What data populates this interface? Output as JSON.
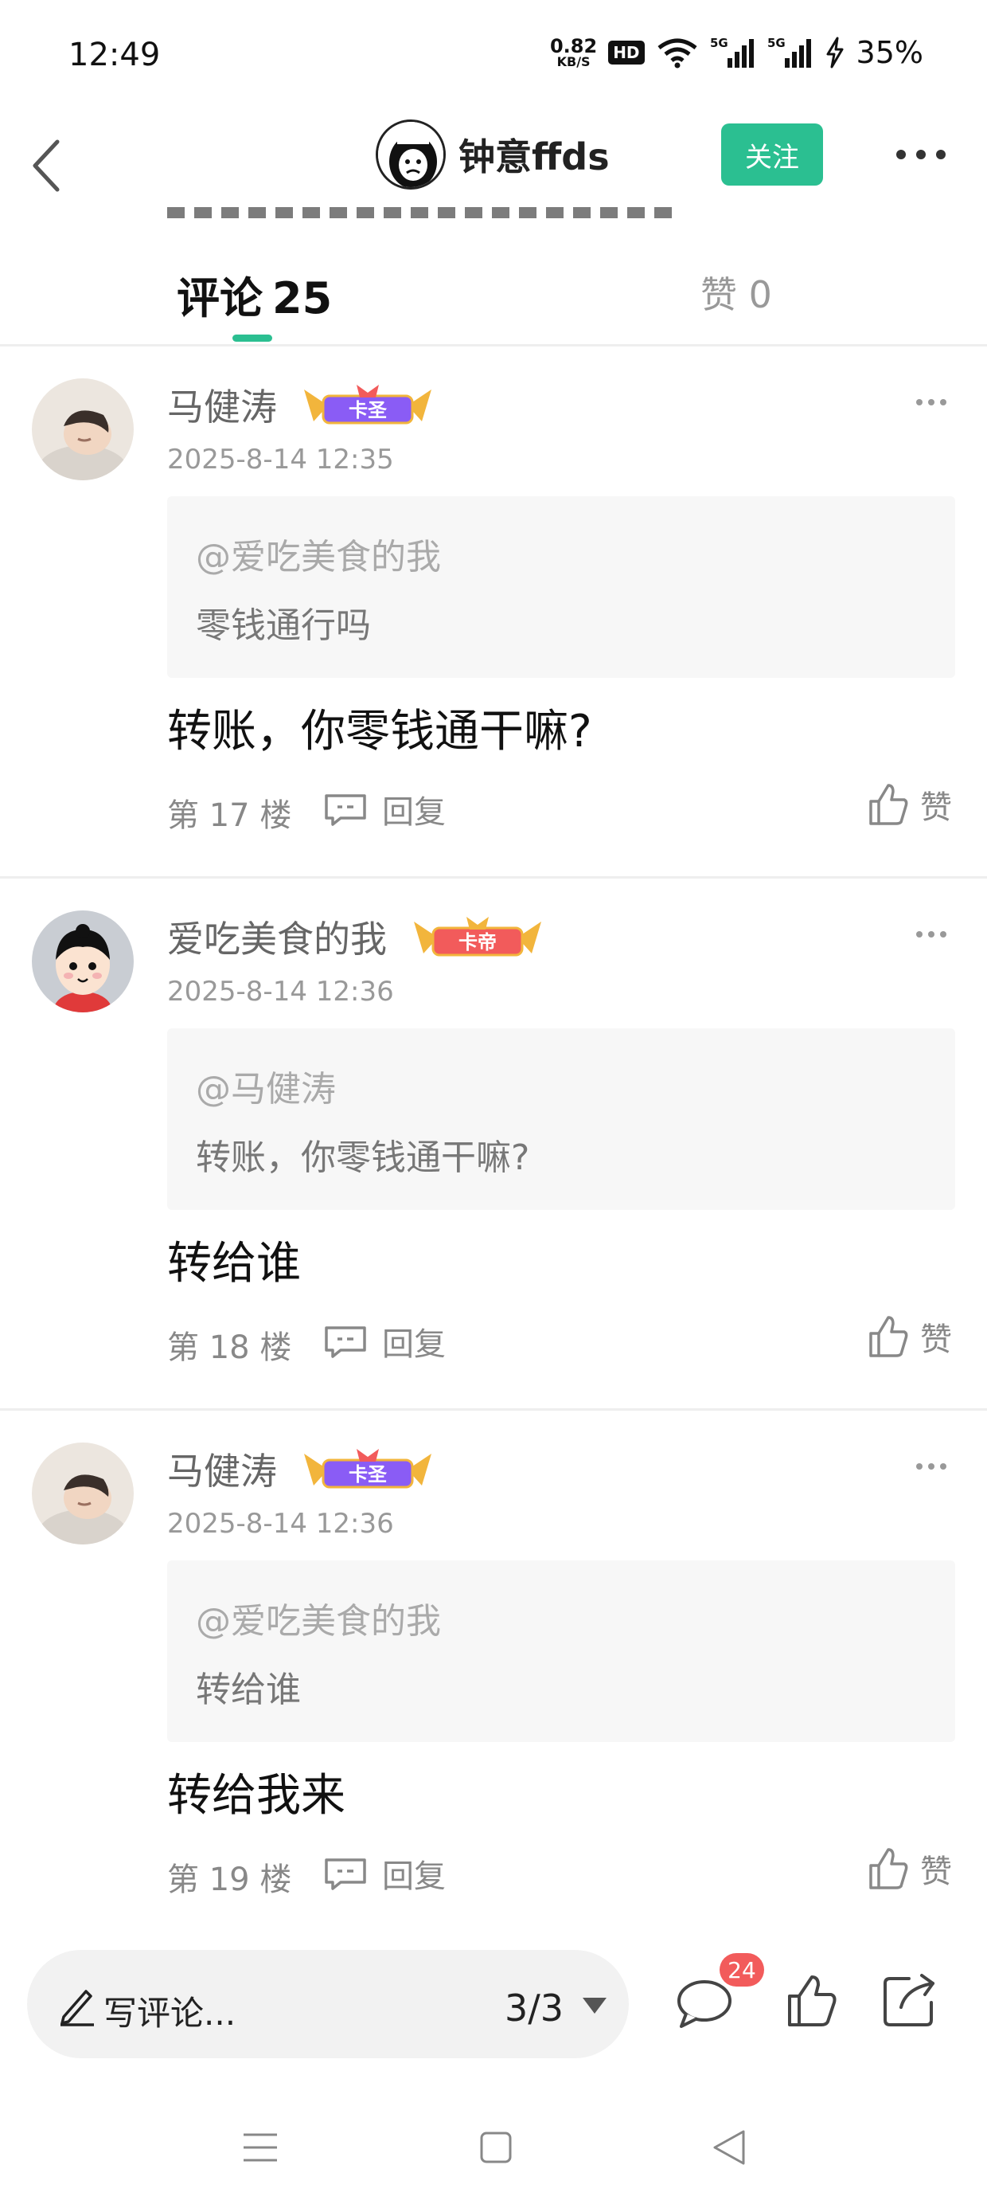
{
  "status_bar": {
    "time": "12:49",
    "net_speed_value": "0.82",
    "net_speed_unit": "KB/S",
    "hd_badge": "HD",
    "network_5g_1": "5G",
    "network_5g_2": "5G",
    "battery": "35%"
  },
  "header": {
    "author_name": "钟意ffds",
    "follow_label": "关注"
  },
  "tabs": {
    "comments_label": "评论",
    "comments_count": "25",
    "likes_label": "赞 0"
  },
  "comments": [
    {
      "username": "马健涛",
      "badge": "卡圣",
      "time": "2025-8-14 12:35",
      "quote_mention": "@爱吃美食的我",
      "quote_text": "零钱通行吗",
      "text": "转账，你零钱通干嘛?",
      "floor": "第 17 楼",
      "reply_label": "回复",
      "like_label": "赞"
    },
    {
      "username": "爱吃美食的我",
      "badge": "卡帝",
      "time": "2025-8-14 12:36",
      "quote_mention": "@马健涛",
      "quote_text": "转账，你零钱通干嘛?",
      "text": "转给谁",
      "floor": "第 18 楼",
      "reply_label": "回复",
      "like_label": "赞"
    },
    {
      "username": "马健涛",
      "badge": "卡圣",
      "time": "2025-8-14 12:36",
      "quote_mention": "@爱吃美食的我",
      "quote_text": "转给谁",
      "text": "转给我来",
      "floor": "第 19 楼",
      "reply_label": "回复",
      "like_label": "赞"
    }
  ],
  "bottom_bar": {
    "write_placeholder": "写评论...",
    "page_indicator": "3/3",
    "comment_count": "24"
  },
  "colors": {
    "accent_green": "#2bbf91",
    "badge_red": "#f25b5b",
    "badge_purple": "#8a5cf5"
  },
  "icons": [
    "back-arrow-icon",
    "more-dots-icon",
    "reply-bubble-icon",
    "thumb-up-icon",
    "pen-icon",
    "dropdown-arrow-icon",
    "comment-icon",
    "share-icon",
    "menu-icon",
    "home-icon",
    "back-triangle-icon"
  ]
}
